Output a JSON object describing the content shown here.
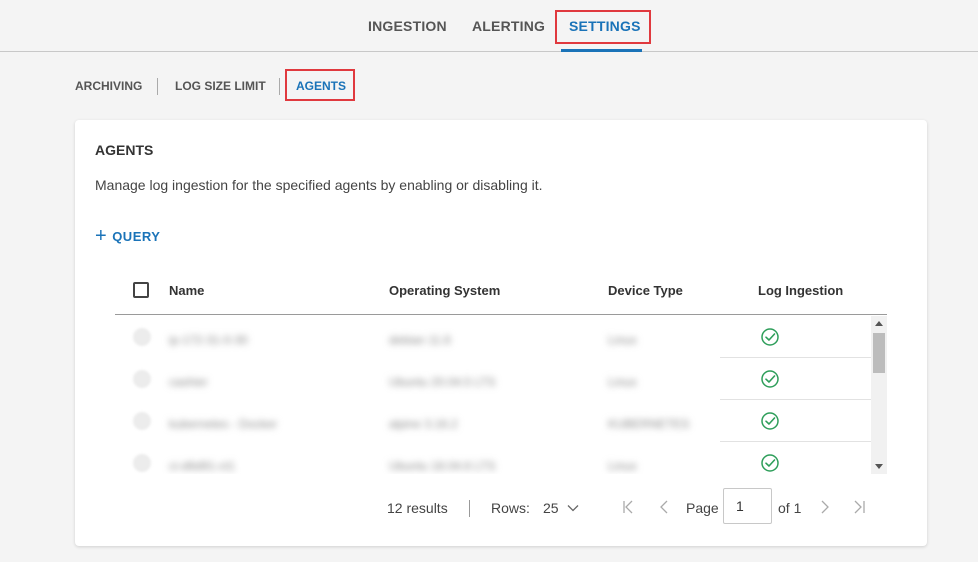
{
  "top_tabs": [
    {
      "label": "INGESTION"
    },
    {
      "label": "ALERTING"
    },
    {
      "label": "SETTINGS"
    }
  ],
  "active_top_tab": "SETTINGS",
  "sub_tabs": [
    {
      "label": "ARCHIVING"
    },
    {
      "label": "LOG SIZE LIMIT"
    },
    {
      "label": "AGENTS"
    }
  ],
  "active_sub_tab": "AGENTS",
  "card": {
    "title": "AGENTS",
    "description": "Manage log ingestion for the specified agents by enabling or disabling it.",
    "query_label": "QUERY"
  },
  "table": {
    "columns": [
      "Name",
      "Operating System",
      "Device Type",
      "Log Ingestion"
    ],
    "rows": [
      {
        "name": "ip-172-31-0-30",
        "os": "debian 11.6",
        "device": "Linux",
        "log_ingestion": "enabled"
      },
      {
        "name": "cashier",
        "os": "Ubuntu 20.04.5 LTS",
        "device": "Linux",
        "log_ingestion": "enabled"
      },
      {
        "name": "kubernetes - Docker",
        "os": "alpine 3.16.2",
        "device": "KUBERNETES",
        "log_ingestion": "enabled"
      },
      {
        "name": "ci-d6d91-ct1",
        "os": "Ubuntu 18.04.6 LTS",
        "device": "Linux",
        "log_ingestion": "enabled"
      }
    ]
  },
  "pagination": {
    "results": "12 results",
    "rows_label": "Rows:",
    "rows_value": "25",
    "page_label": "Page",
    "page_value": "1",
    "of_label": "of 1"
  },
  "colors": {
    "accent": "#1a73b8",
    "highlight": "#e0393e",
    "success": "#2e9e5a"
  }
}
